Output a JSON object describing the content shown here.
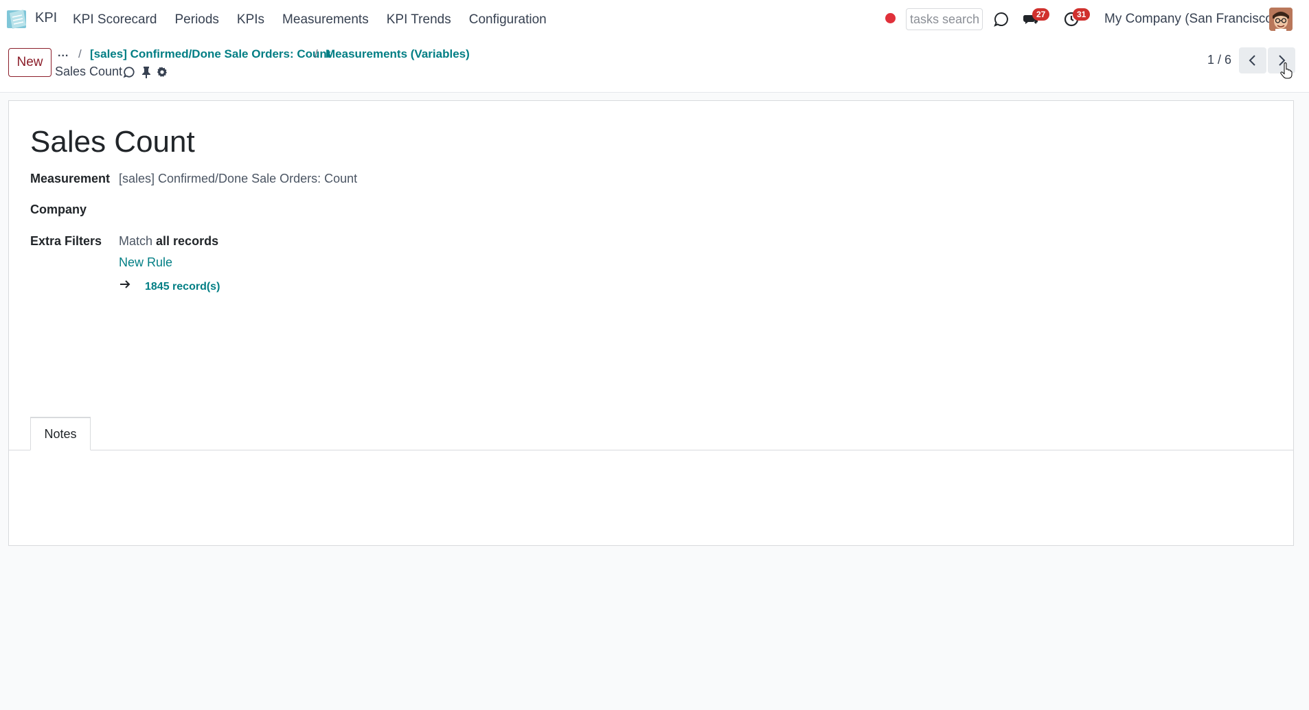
{
  "navbar": {
    "app_name": "KPI",
    "menu": [
      "KPI Scorecard",
      "Periods",
      "KPIs",
      "Measurements",
      "KPI Trends",
      "Configuration"
    ],
    "search_placeholder": "tasks search",
    "messages_badge": "27",
    "activities_badge": "31",
    "company": "My Company (San Francisco)"
  },
  "control_panel": {
    "new_label": "New",
    "breadcrumb_ellipsis": "...",
    "breadcrumbs": [
      "[sales] Confirmed/Done Sale Orders: Count",
      "Measurements (Variables)"
    ],
    "separator": "/",
    "record_name": "Sales Count",
    "pager_value": "1 / 6"
  },
  "form": {
    "title": "Sales Count",
    "measurement_label": "Measurement",
    "measurement_value": "[sales] Confirmed/Done Sale Orders: Count",
    "company_label": "Company",
    "extra_filters_label": "Extra Filters",
    "match_prefix": "Match ",
    "match_bold": "all records",
    "new_rule_label": "New Rule",
    "records_count": "1845 record(s)",
    "tab_notes": "Notes"
  },
  "colors": {
    "accent": "#017e84",
    "brand": "#8b1e2a",
    "badge": "#d0312d",
    "record_dot": "#e0303a"
  }
}
